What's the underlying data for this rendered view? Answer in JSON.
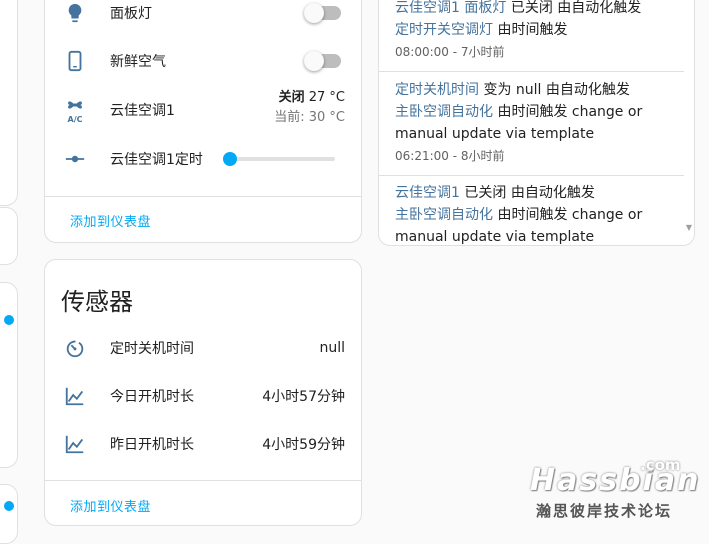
{
  "controls": {
    "rows": [
      {
        "label": "面板灯",
        "state": "off"
      },
      {
        "label": "新鲜空气",
        "state": "off"
      },
      {
        "label": "云佳空调1",
        "climate_state": "关闭",
        "climate_target": "27 °C",
        "climate_current": "当前: 30 °C"
      },
      {
        "label": "云佳空调1定时",
        "slider_value": 0
      }
    ],
    "add_to_dashboard": "添加到仪表盘"
  },
  "sensors": {
    "title": "传感器",
    "rows": [
      {
        "label": "定时关机时间",
        "value": "null"
      },
      {
        "label": "今日开机时长",
        "value": "4小时57分钟"
      },
      {
        "label": "昨日开机时长",
        "value": "4小时59分钟"
      }
    ],
    "add_to_dashboard": "添加到仪表盘"
  },
  "logbook": {
    "entries": [
      {
        "l1_e1": "云佳空调1",
        "l1_e2": "面板灯",
        "l1_t": " 已关闭 由自动化触发",
        "l2_e": "定时开关空调灯",
        "l2_t": " 由时间触发",
        "time": "08:00:00 - 7小时前"
      },
      {
        "l1_e": "定时关机时间",
        "l1_t": " 变为 null 由自动化触发",
        "l2_e": "主卧空调自动化",
        "l2_t": " 由时间触发 change or",
        "l3": "manual update via template",
        "time": "06:21:00 - 8小时前"
      },
      {
        "l1_e": "云佳空调1",
        "l1_t": " 已关闭 由自动化触发",
        "l2_e": "主卧空调自动化",
        "l2_t": " 由时间触发 change or",
        "l3": "manual update via template"
      }
    ]
  },
  "watermark": {
    "brand": "Hassbian",
    "tld": ".com",
    "sub": "瀚思彼岸技术论坛"
  },
  "colors": {
    "accent": "#03a9f4",
    "icon": "#44739e",
    "entity_link": "#44739e"
  }
}
